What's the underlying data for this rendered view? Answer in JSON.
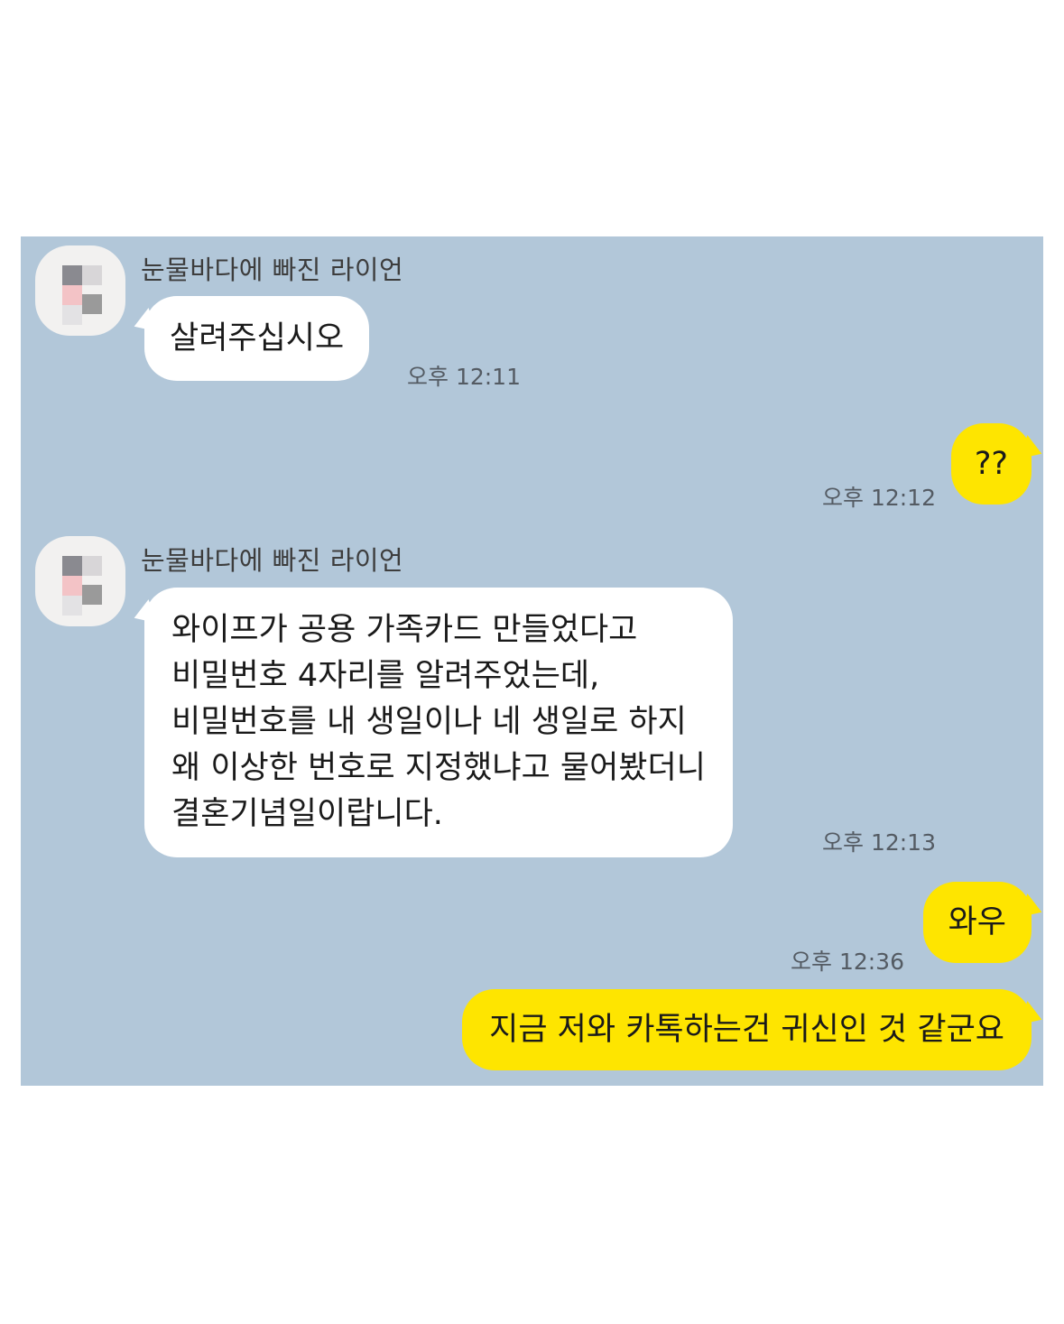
{
  "chat": {
    "background_color": "#b2c7d9",
    "incoming_bubble_color": "#ffffff",
    "outgoing_bubble_color": "#fee500",
    "messages": [
      {
        "direction": "incoming",
        "sender": "눈물바다에 빠진 라이언",
        "avatar": "pixelated-profile-avatar",
        "lines": [
          "살려주십시오"
        ],
        "time": "오후 12:11"
      },
      {
        "direction": "outgoing",
        "lines": [
          "??"
        ],
        "time": "오후 12:12"
      },
      {
        "direction": "incoming",
        "sender": "눈물바다에 빠진 라이언",
        "avatar": "pixelated-profile-avatar",
        "lines": [
          "와이프가 공용 가족카드 만들었다고",
          "비밀번호 4자리를 알려주었는데,",
          "비밀번호를 내 생일이나 네 생일로 하지",
          "왜 이상한 번호로 지정했냐고 물어봤더니",
          "결혼기념일이랍니다."
        ],
        "time": "오후 12:13"
      },
      {
        "direction": "outgoing",
        "lines": [
          "와우"
        ],
        "time": "오후 12:36"
      },
      {
        "direction": "outgoing",
        "lines": [
          "지금 저와 카톡하는건 귀신인 것 같군요"
        ],
        "time": ""
      }
    ]
  }
}
